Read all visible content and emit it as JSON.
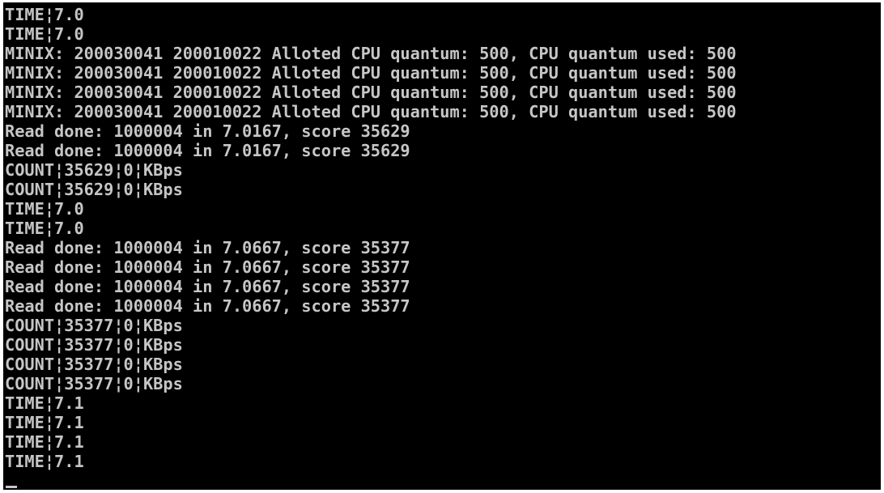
{
  "console": {
    "lines": [
      "TIME¦7.0",
      "TIME¦7.0",
      "MINIX: 200030041 200010022 Alloted CPU quantum: 500, CPU quantum used: 500",
      "MINIX: 200030041 200010022 Alloted CPU quantum: 500, CPU quantum used: 500",
      "MINIX: 200030041 200010022 Alloted CPU quantum: 500, CPU quantum used: 500",
      "MINIX: 200030041 200010022 Alloted CPU quantum: 500, CPU quantum used: 500",
      "Read done: 1000004 in 7.0167, score 35629",
      "Read done: 1000004 in 7.0167, score 35629",
      "COUNT¦35629¦0¦KBps",
      "COUNT¦35629¦0¦KBps",
      "TIME¦7.0",
      "TIME¦7.0",
      "Read done: 1000004 in 7.0667, score 35377",
      "Read done: 1000004 in 7.0667, score 35377",
      "Read done: 1000004 in 7.0667, score 35377",
      "Read done: 1000004 in 7.0667, score 35377",
      "COUNT¦35377¦0¦KBps",
      "COUNT¦35377¦0¦KBps",
      "COUNT¦35377¦0¦KBps",
      "COUNT¦35377¦0¦KBps",
      "TIME¦7.1",
      "TIME¦7.1",
      "TIME¦7.1",
      "TIME¦7.1"
    ]
  },
  "colors": {
    "background": "#000000",
    "text": "#c6c6c6",
    "frame": "#ffffff"
  }
}
